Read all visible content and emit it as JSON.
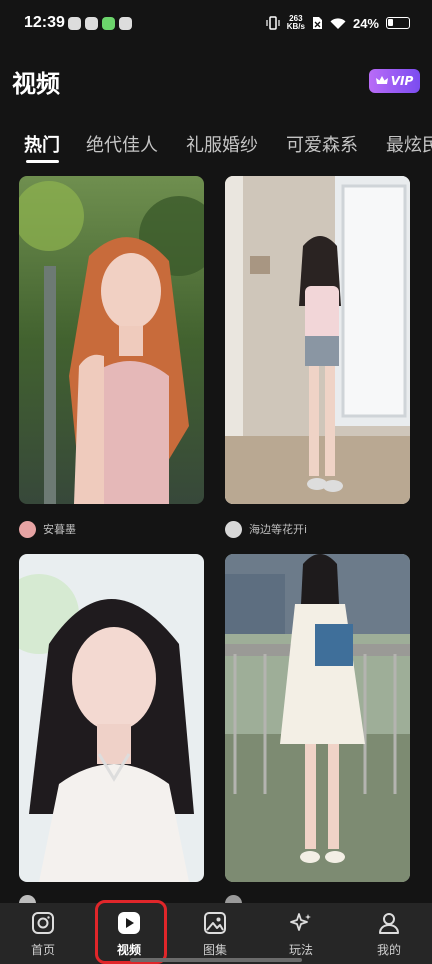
{
  "status": {
    "time": "12:39",
    "net_speed_top": "263",
    "net_speed_bottom": "KB/s",
    "battery": "24%"
  },
  "header": {
    "title": "视频",
    "vip_label": "VIP"
  },
  "tabs": [
    {
      "label": "热门",
      "active": true
    },
    {
      "label": "绝代佳人"
    },
    {
      "label": "礼服婚纱"
    },
    {
      "label": "可爱森系"
    },
    {
      "label": "最炫民"
    }
  ],
  "feed": [
    {
      "author": "安暮墨"
    },
    {
      "author": "海边等花开i"
    },
    {
      "author": ""
    },
    {
      "author": ""
    }
  ],
  "bottom_nav": [
    {
      "label": "首页",
      "icon": "instagram-camera-icon"
    },
    {
      "label": "视频",
      "icon": "play-icon",
      "active": true
    },
    {
      "label": "图集",
      "icon": "image-gallery-icon"
    },
    {
      "label": "玩法",
      "icon": "sparkle-icon"
    },
    {
      "label": "我的",
      "icon": "person-icon"
    }
  ],
  "colors": {
    "background": "#141414",
    "vip_gradient_start": "#b96cf7",
    "vip_gradient_end": "#7b4cf0",
    "nav_bg": "#262626",
    "highlight": "#e0262a"
  }
}
